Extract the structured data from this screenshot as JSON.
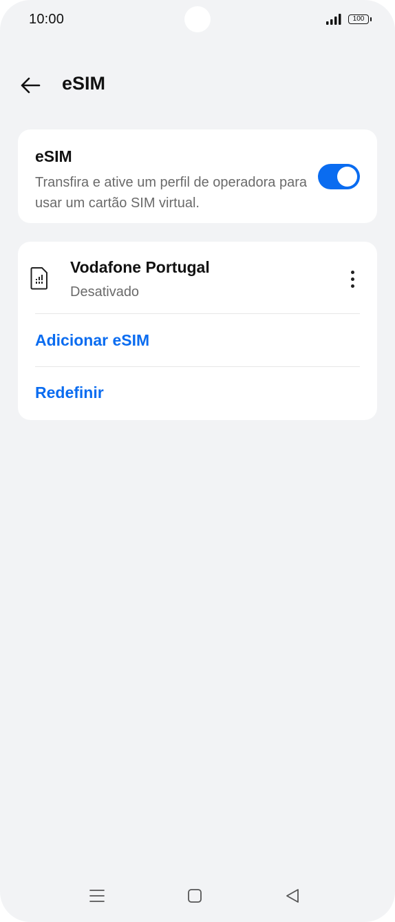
{
  "status_bar": {
    "time": "10:00",
    "battery": "100",
    "icons": [
      "signal-icon",
      "battery-icon"
    ]
  },
  "header": {
    "title": "eSIM",
    "back_icon": "arrow-left-icon"
  },
  "esim_card": {
    "title": "eSIM",
    "description": "Transfira e ative um perfil de operadora para usar um cartão SIM virtual.",
    "toggle_on": true
  },
  "profile_card": {
    "profile": {
      "name": "Vodafone Portugal",
      "status": "Desativado",
      "icon": "sim-card-icon",
      "menu_icon": "more-vertical-icon"
    },
    "add_label": "Adicionar eSIM",
    "reset_label": "Redefinir"
  },
  "nav_bar": {
    "icons": [
      "menu-icon",
      "home-icon",
      "back-icon"
    ]
  },
  "colors": {
    "accent": "#0a6cf0",
    "background": "#f2f3f5",
    "card": "#ffffff",
    "text_primary": "#111111",
    "text_secondary": "#6a6a6a"
  }
}
